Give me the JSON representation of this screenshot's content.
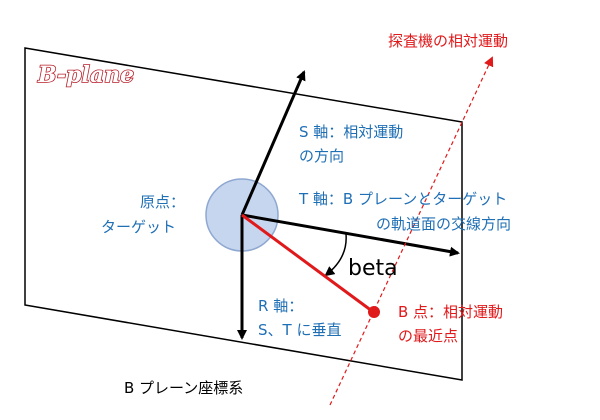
{
  "plane_title": "B-plane",
  "spacecraft_motion": "探査機の相対運動",
  "s_axis": {
    "line1": "S 軸：相対運動",
    "line2": "の方向"
  },
  "t_axis": {
    "line1": "T 軸：B プレーンとターゲット",
    "line2": "の軌道面の交線方向"
  },
  "r_axis": {
    "line1": "R 軸：",
    "line2": "S、T に垂直"
  },
  "origin": {
    "line1": "原点：",
    "line2": "ターゲット"
  },
  "b_point": {
    "line1": "B 点：相対運動",
    "line2": "の最近点"
  },
  "angle_label": "beta",
  "caption": "B プレーン座標系",
  "colors": {
    "blue_text": "#1f6fb5",
    "red": "#e0191b",
    "target_fill": "#c3d4ee",
    "target_stroke": "#8aa4cf",
    "title_stroke": "#b8202a"
  }
}
